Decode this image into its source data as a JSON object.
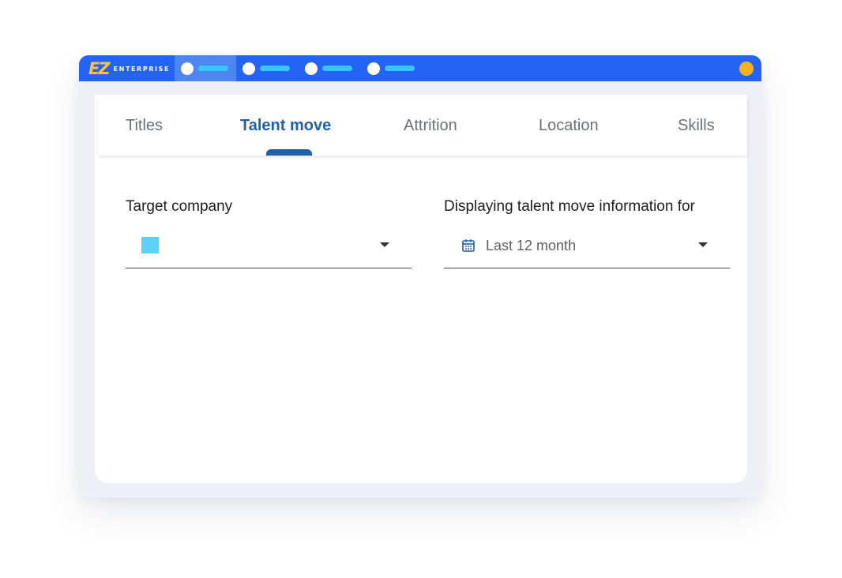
{
  "app": {
    "logo_mark": "EZ",
    "logo_text": "ENTERPRISE"
  },
  "colors": {
    "titlebar": "#2563f5",
    "active_tab": "#1f5fab",
    "logo_yellow": "#ffc23d",
    "company_swatch": "#5dd1f5",
    "window_dot": "#f6b21b"
  },
  "tabs": [
    {
      "label": "Titles",
      "selected": false
    },
    {
      "label": "Talent move",
      "selected": true
    },
    {
      "label": "Attrition",
      "selected": false
    },
    {
      "label": "Location",
      "selected": false
    },
    {
      "label": "Skills",
      "selected": false
    }
  ],
  "target_company": {
    "label": "Target company",
    "value": "",
    "icon": "chevron-down-icon"
  },
  "period": {
    "label": "Displaying talent move information for",
    "value": "Last 12 month",
    "icon": "calendar-icon"
  }
}
